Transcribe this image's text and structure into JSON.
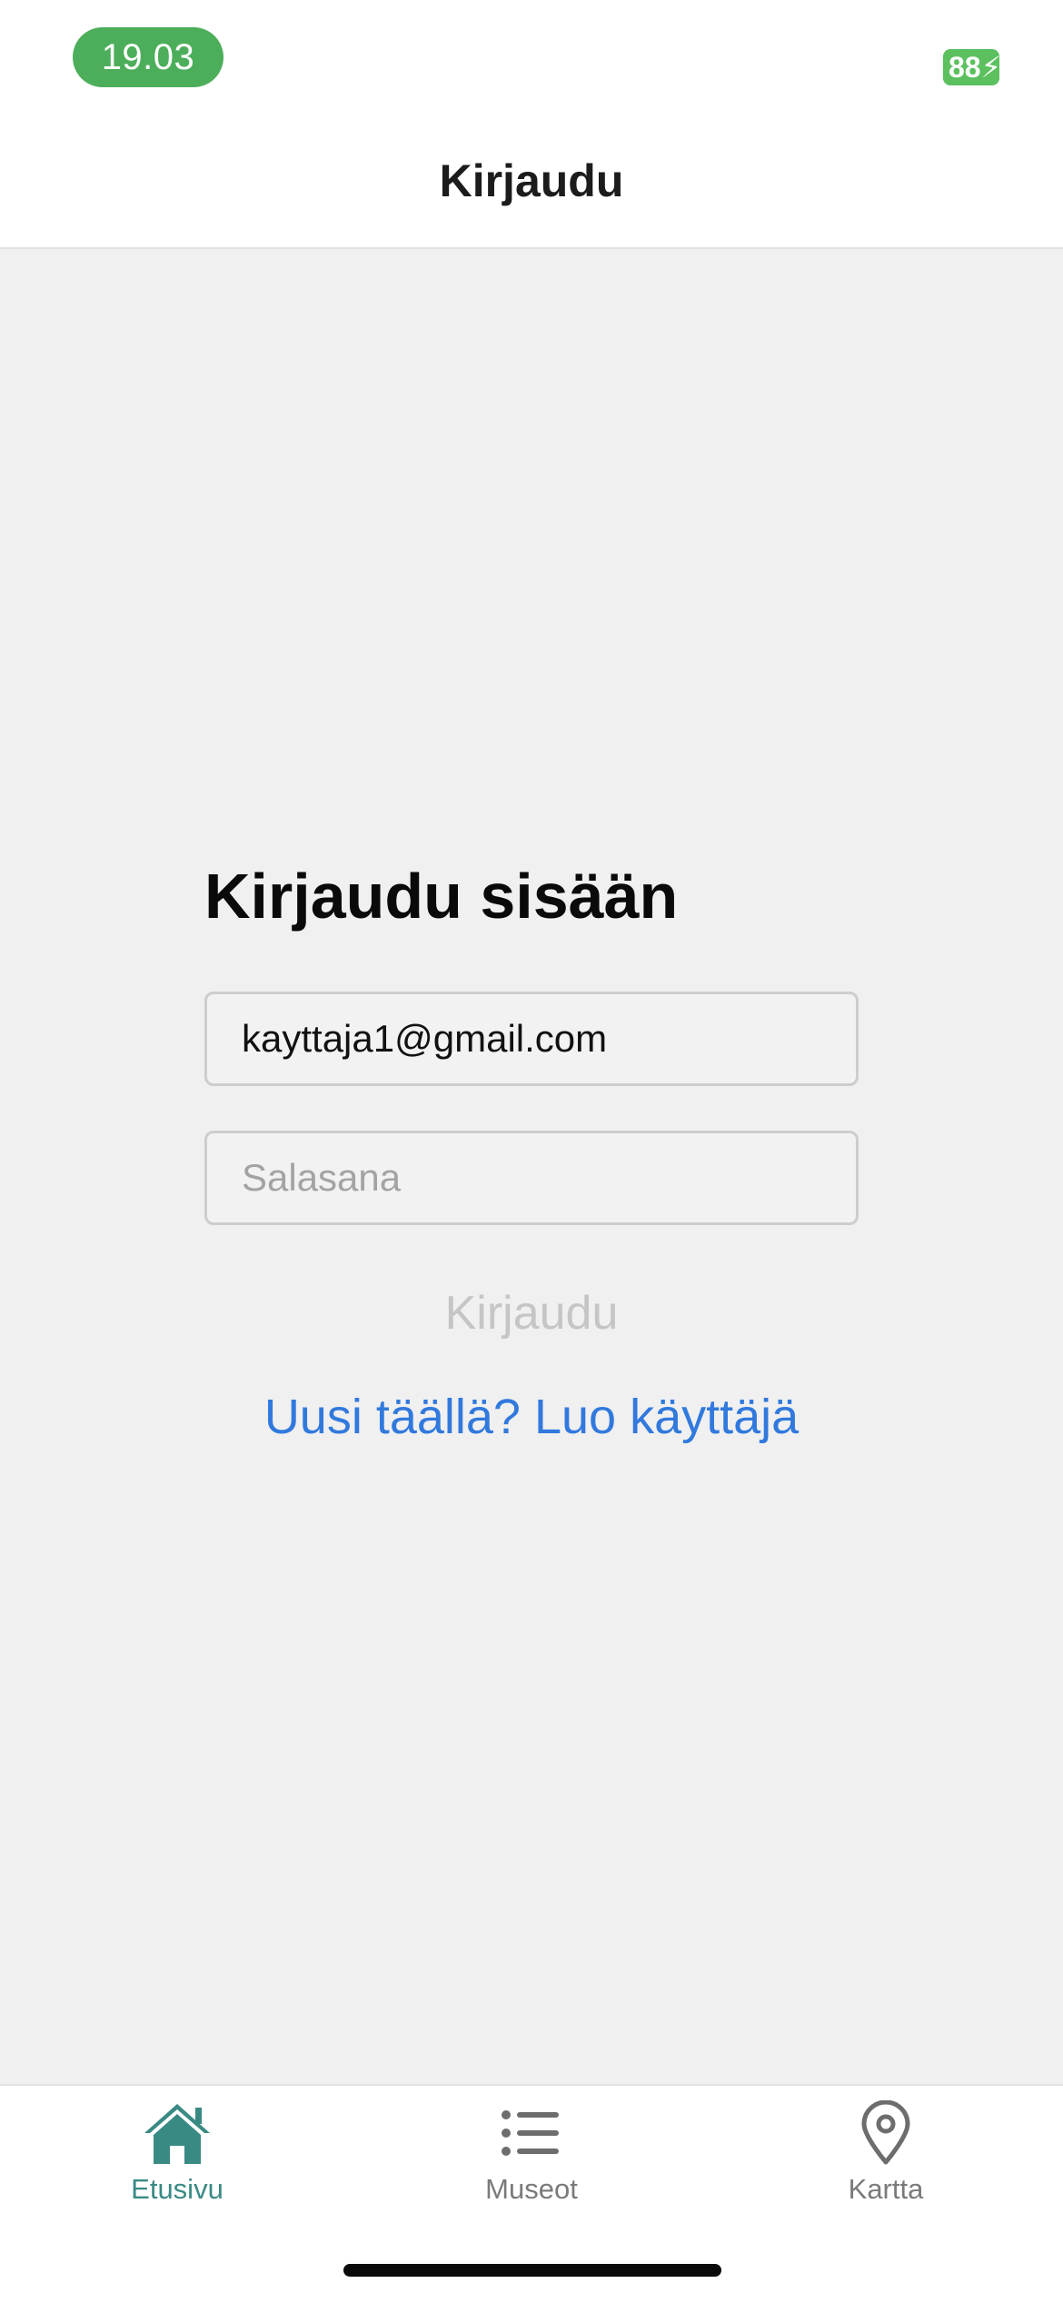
{
  "status_bar": {
    "time": "19.03",
    "battery_level": "88"
  },
  "header": {
    "title": "Kirjaudu"
  },
  "login_form": {
    "heading": "Kirjaudu sisään",
    "email": {
      "value": "kayttaja1@gmail.com"
    },
    "password": {
      "placeholder": "Salasana"
    },
    "submit_label": "Kirjaudu",
    "signup_link": "Uusi täällä? Luo käyttäjä"
  },
  "tab_bar": {
    "tabs": [
      {
        "label": "Etusivu",
        "icon": "home-icon",
        "active": true
      },
      {
        "label": "Museot",
        "icon": "list-icon",
        "active": false
      },
      {
        "label": "Kartta",
        "icon": "map-pin-icon",
        "active": false
      }
    ]
  },
  "colors": {
    "accent": "#3a8a84",
    "link": "#3179dd",
    "status_green": "#4cae5a",
    "background": "#f0f0f0"
  }
}
